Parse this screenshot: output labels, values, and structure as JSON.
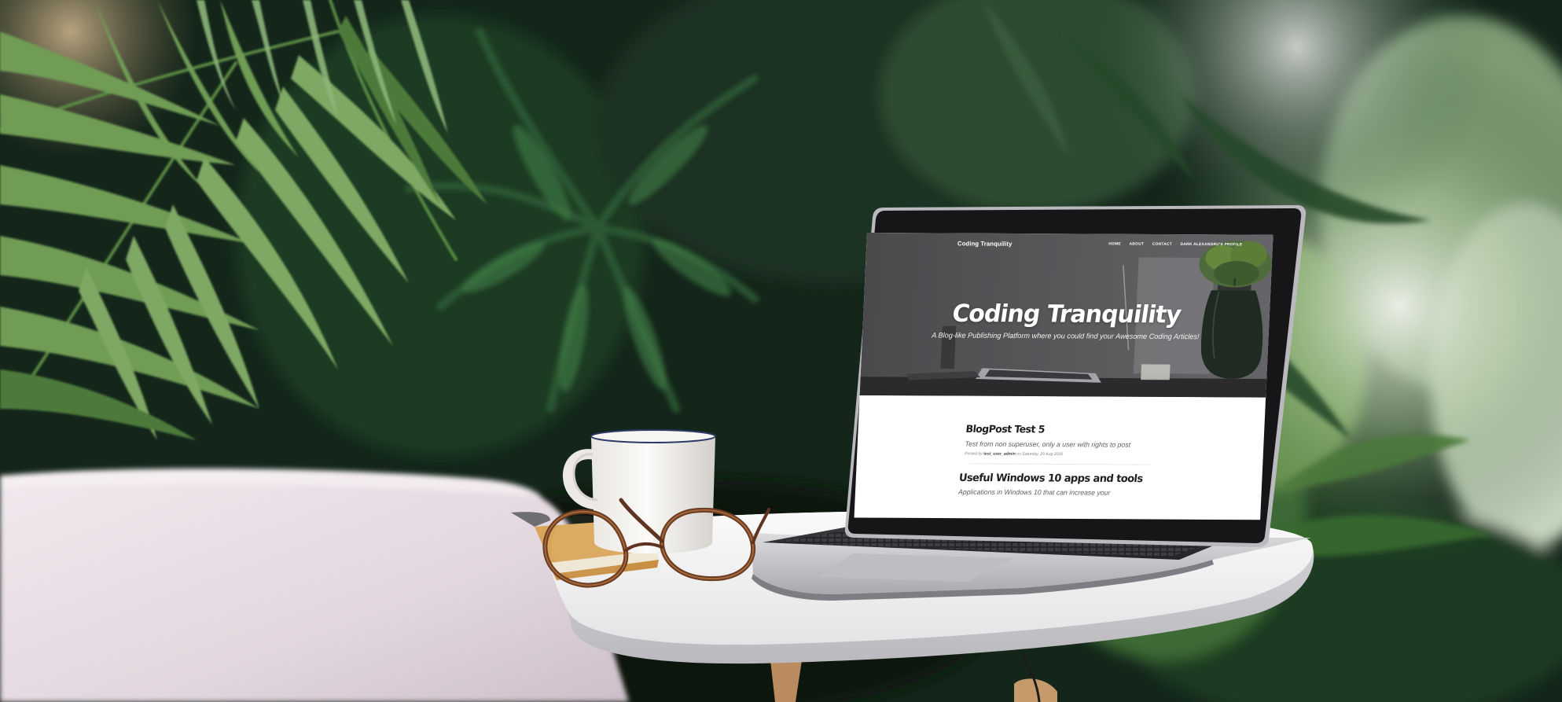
{
  "website": {
    "brand": "Coding Tranquility",
    "nav": [
      "HOME",
      "ABOUT",
      "CONTACT",
      "DARK ALEXANDRU'S PROFILE"
    ],
    "hero_title": "Coding Tranquility",
    "hero_subtitle": "A Blog-like Publishing Platform where you could find your Awesome Coding Articles!",
    "posts": [
      {
        "title": "BlogPost Test 5",
        "subtitle": "Test from non superuser, only a user with rights to post",
        "meta_prefix": "Posted by",
        "author": "test_user_admin",
        "meta_suffix": "on Saturday, 29 Aug 2020"
      },
      {
        "title": "Useful Windows 10 apps and tools",
        "subtitle": "Applications in Windows 10 that can increase your"
      }
    ]
  },
  "colors": {
    "foliage_dark": "#0f1e13",
    "foliage_mid": "#2e5233",
    "foliage_light": "#7fa566",
    "table": "#f3f3f3",
    "chair": "#e8dde4",
    "laptop_bezel": "#1c1c1e",
    "laptop_body": "#c9c9cc"
  }
}
